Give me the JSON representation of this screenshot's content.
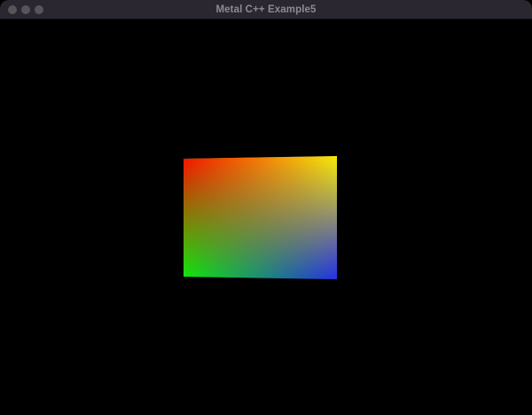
{
  "window": {
    "title": "Metal C++ Example5"
  },
  "colors": {
    "titlebar_bg": "#2b2730",
    "title_text": "#8d8a91",
    "traffic_light_inactive": "#57545a",
    "view_background": "#000000",
    "corner_top_left": "#ff0000",
    "corner_top_right": "#ffff00",
    "corner_bottom_left": "#00ff00",
    "corner_bottom_right": "#1a1aff"
  }
}
